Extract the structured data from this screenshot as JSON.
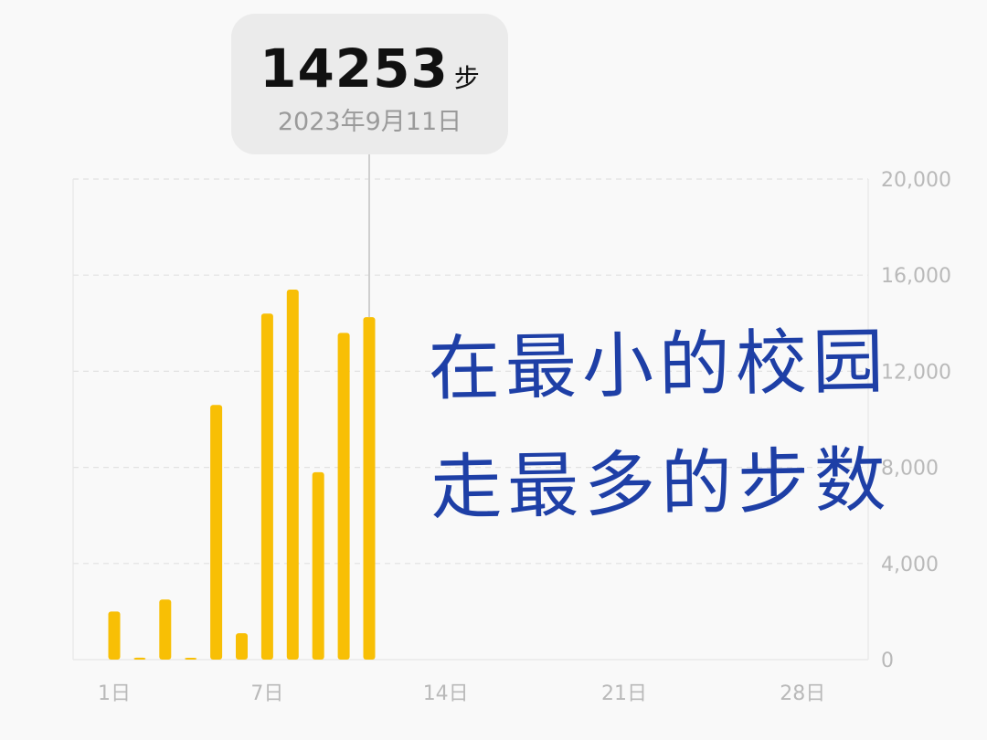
{
  "tooltip": {
    "value": "14253",
    "unit": "步",
    "date": "2023年9月11日"
  },
  "annotation": {
    "line1": "在最小的校园",
    "line2": "走最多的步数"
  },
  "colors": {
    "bar": "#f8bf05",
    "handwriting": "#1e3fa6",
    "tooltip_bg": "#ebebeb"
  },
  "chart_data": {
    "type": "bar",
    "title": "",
    "xlabel": "",
    "ylabel": "",
    "x": [
      1,
      2,
      3,
      4,
      5,
      6,
      7,
      8,
      9,
      10,
      11,
      12,
      13,
      14,
      15,
      16,
      17,
      18,
      19,
      20,
      21,
      22,
      23,
      24,
      25,
      26,
      27,
      28,
      29,
      30
    ],
    "values": [
      2000,
      80,
      2500,
      30,
      10600,
      1100,
      14400,
      15400,
      7800,
      13600,
      14253,
      0,
      0,
      0,
      0,
      0,
      0,
      0,
      0,
      0,
      0,
      0,
      0,
      0,
      0,
      0,
      0,
      0,
      0,
      0
    ],
    "selected_index": 10,
    "ylim": [
      0,
      20000
    ],
    "y_ticks": [
      0,
      4000,
      8000,
      12000,
      16000,
      20000
    ],
    "y_tick_labels": [
      "0",
      "4,000",
      "8,000",
      "12,000",
      "16,000",
      "20,000"
    ],
    "x_ticks": [
      1,
      7,
      14,
      21,
      28
    ],
    "x_tick_labels": [
      "1日",
      "7日",
      "14日",
      "21日",
      "28日"
    ],
    "grid": true,
    "y_axis_position": "right"
  }
}
